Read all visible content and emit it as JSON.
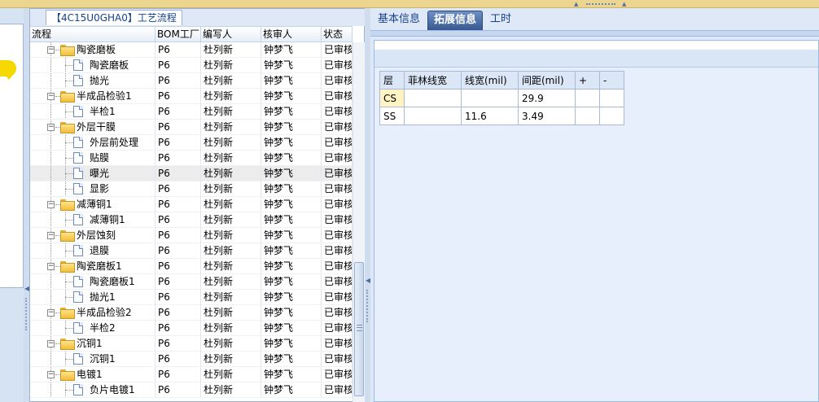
{
  "tree": {
    "title": "【4C15U0GHA0】工艺流程",
    "columns": [
      "流程",
      "BOM工厂",
      "编写人",
      "核审人",
      "状态"
    ],
    "rows": [
      {
        "flow": "陶瓷磨板",
        "type": "folder",
        "level": 0,
        "bom": "P6",
        "writer": "杜列新",
        "reviewer": "钟梦飞",
        "status": "已审核"
      },
      {
        "flow": "陶瓷磨板",
        "type": "doc",
        "level": 1,
        "bom": "P6",
        "writer": "杜列新",
        "reviewer": "钟梦飞",
        "status": "已审核"
      },
      {
        "flow": "抛光",
        "type": "doc",
        "level": 1,
        "bom": "P6",
        "writer": "杜列新",
        "reviewer": "钟梦飞",
        "status": "已审核"
      },
      {
        "flow": "半成品检验1",
        "type": "folder",
        "level": 0,
        "bom": "P6",
        "writer": "杜列新",
        "reviewer": "钟梦飞",
        "status": "已审核"
      },
      {
        "flow": "半检1",
        "type": "doc",
        "level": 1,
        "bom": "P6",
        "writer": "杜列新",
        "reviewer": "钟梦飞",
        "status": "已审核"
      },
      {
        "flow": "外层干膜",
        "type": "folder",
        "level": 0,
        "bom": "P6",
        "writer": "杜列新",
        "reviewer": "钟梦飞",
        "status": "已审核"
      },
      {
        "flow": "外层前处理",
        "type": "doc",
        "level": 1,
        "bom": "P6",
        "writer": "杜列新",
        "reviewer": "钟梦飞",
        "status": "已审核"
      },
      {
        "flow": "贴膜",
        "type": "doc",
        "level": 1,
        "bom": "P6",
        "writer": "杜列新",
        "reviewer": "钟梦飞",
        "status": "已审核"
      },
      {
        "flow": "曝光",
        "type": "doc",
        "level": 1,
        "bom": "P6",
        "writer": "杜列新",
        "reviewer": "钟梦飞",
        "status": "已审核",
        "selected": true
      },
      {
        "flow": "显影",
        "type": "doc",
        "level": 1,
        "bom": "P6",
        "writer": "杜列新",
        "reviewer": "钟梦飞",
        "status": "已审核"
      },
      {
        "flow": "减薄铜1",
        "type": "folder",
        "level": 0,
        "bom": "P6",
        "writer": "杜列新",
        "reviewer": "钟梦飞",
        "status": "已审核"
      },
      {
        "flow": "减薄铜1",
        "type": "doc",
        "level": 1,
        "bom": "P6",
        "writer": "杜列新",
        "reviewer": "钟梦飞",
        "status": "已审核"
      },
      {
        "flow": "外层蚀刻",
        "type": "folder",
        "level": 0,
        "bom": "P6",
        "writer": "杜列新",
        "reviewer": "钟梦飞",
        "status": "已审核"
      },
      {
        "flow": "退膜",
        "type": "doc",
        "level": 1,
        "bom": "P6",
        "writer": "杜列新",
        "reviewer": "钟梦飞",
        "status": "已审核"
      },
      {
        "flow": "陶瓷磨板1",
        "type": "folder",
        "level": 0,
        "bom": "P6",
        "writer": "杜列新",
        "reviewer": "钟梦飞",
        "status": "已审核"
      },
      {
        "flow": "陶瓷磨板1",
        "type": "doc",
        "level": 1,
        "bom": "P6",
        "writer": "杜列新",
        "reviewer": "钟梦飞",
        "status": "已审核"
      },
      {
        "flow": "抛光1",
        "type": "doc",
        "level": 1,
        "bom": "P6",
        "writer": "杜列新",
        "reviewer": "钟梦飞",
        "status": "已审核"
      },
      {
        "flow": "半成品检验2",
        "type": "folder",
        "level": 0,
        "bom": "P6",
        "writer": "杜列新",
        "reviewer": "钟梦飞",
        "status": "已审核"
      },
      {
        "flow": "半检2",
        "type": "doc",
        "level": 1,
        "bom": "P6",
        "writer": "杜列新",
        "reviewer": "钟梦飞",
        "status": "已审核"
      },
      {
        "flow": "沉铜1",
        "type": "folder",
        "level": 0,
        "bom": "P6",
        "writer": "杜列新",
        "reviewer": "钟梦飞",
        "status": "已审核"
      },
      {
        "flow": "沉铜1",
        "type": "doc",
        "level": 1,
        "bom": "P6",
        "writer": "杜列新",
        "reviewer": "钟梦飞",
        "status": "已审核"
      },
      {
        "flow": "电镀1",
        "type": "folder",
        "level": 0,
        "bom": "P6",
        "writer": "杜列新",
        "reviewer": "钟梦飞",
        "status": "已审核"
      },
      {
        "flow": "负片电镀1",
        "type": "doc",
        "level": 1,
        "bom": "P6",
        "writer": "杜列新",
        "reviewer": "钟梦飞",
        "status": "已审核"
      }
    ]
  },
  "tabs": [
    {
      "label": "基本信息",
      "active": false
    },
    {
      "label": "拓展信息",
      "active": true
    },
    {
      "label": "工时",
      "active": false
    }
  ],
  "ext_table": {
    "headers": [
      "层",
      "菲林线宽",
      "线宽(mil)",
      "间距(mil)",
      "+",
      "-"
    ],
    "rows": [
      [
        "CS",
        "",
        "",
        "29.9",
        "",
        ""
      ],
      [
        "SS",
        "",
        "11.6",
        "3.49",
        "",
        ""
      ]
    ]
  }
}
